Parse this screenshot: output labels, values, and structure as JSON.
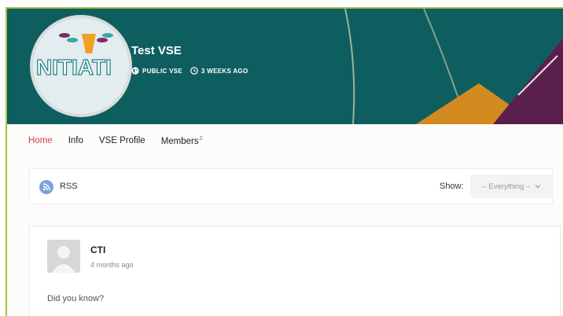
{
  "group": {
    "title": "Test VSE",
    "visibility": "PUBLIC VSE",
    "active": "3 WEEKS AGO",
    "logo_text": "NITIATI"
  },
  "nav": {
    "items": [
      {
        "label": "Home",
        "active": true
      },
      {
        "label": "Info"
      },
      {
        "label": "VSE Profile"
      },
      {
        "label": "Members",
        "badge": "2"
      }
    ]
  },
  "filter": {
    "rss_label": "RSS",
    "show_label": "Show:",
    "selected": "– Everything –"
  },
  "post": {
    "author": "CTI",
    "time": "4 months ago",
    "body": "Did you know?"
  },
  "colors": {
    "cover_bg": "#0f5e5f",
    "accent": "#d9414b",
    "frame_border": "#a9c23f"
  }
}
